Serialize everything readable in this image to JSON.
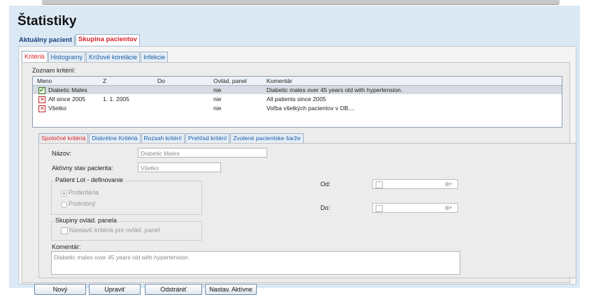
{
  "page_title": "Štatistiky",
  "main_tabs": [
    "Aktuálny pacient",
    "Skupina pacientov"
  ],
  "sub_tabs": [
    "Kritériá",
    "Histogramy",
    "Krížové korelácie",
    "Infekcie"
  ],
  "criteria_list": {
    "label": "Zoznam kritérií:",
    "columns": [
      "Meno",
      "Z",
      "Do",
      "Ovlád. panel",
      "Komentár"
    ],
    "rows": [
      {
        "icon": "check-icon",
        "name": "Diabetic Males",
        "from": "",
        "to": "",
        "panel": "nie",
        "comment": "Diabetic males over 45 years old with hypertension."
      },
      {
        "icon": "cross-icon",
        "name": "All since 2005",
        "from": "1. 1. 2005",
        "to": "",
        "panel": "nie",
        "comment": "All patients since 2005"
      },
      {
        "icon": "cross-icon",
        "name": "Všetko",
        "from": "",
        "to": "",
        "panel": "nie",
        "comment": "Voľba všetkých pacientov v DB...."
      }
    ]
  },
  "detail_tabs": [
    "Spoločné kritériá",
    "Diskrétne Kritériá",
    "Rozsah kritérií",
    "Prehľad kritérií",
    "Zvolené pacientske šarže"
  ],
  "form": {
    "name_label": "Názov:",
    "name_value": "Diabetic Males",
    "status_label": "Aktívny stav pacienta:",
    "status_value": "Všetko",
    "lot_group_title": "Patient Lot - definovanie",
    "radio_sub": "Podkritéria",
    "radio_detail": "Podrobný",
    "panel_group_title": "Skupiny ovlád. panela",
    "panel_checkbox": "Nastaviť kritériá pre ovlád. panel",
    "from_label": "Od:",
    "to_label": "Do:",
    "comment_label": "Komentár:",
    "comment_value": "Diabetic males over 45 years old with hypertension."
  },
  "buttons": {
    "new": "Nový",
    "edit": "Upraviť",
    "delete": "Odstrániť",
    "set_active": "Nastav. Aktívne"
  }
}
